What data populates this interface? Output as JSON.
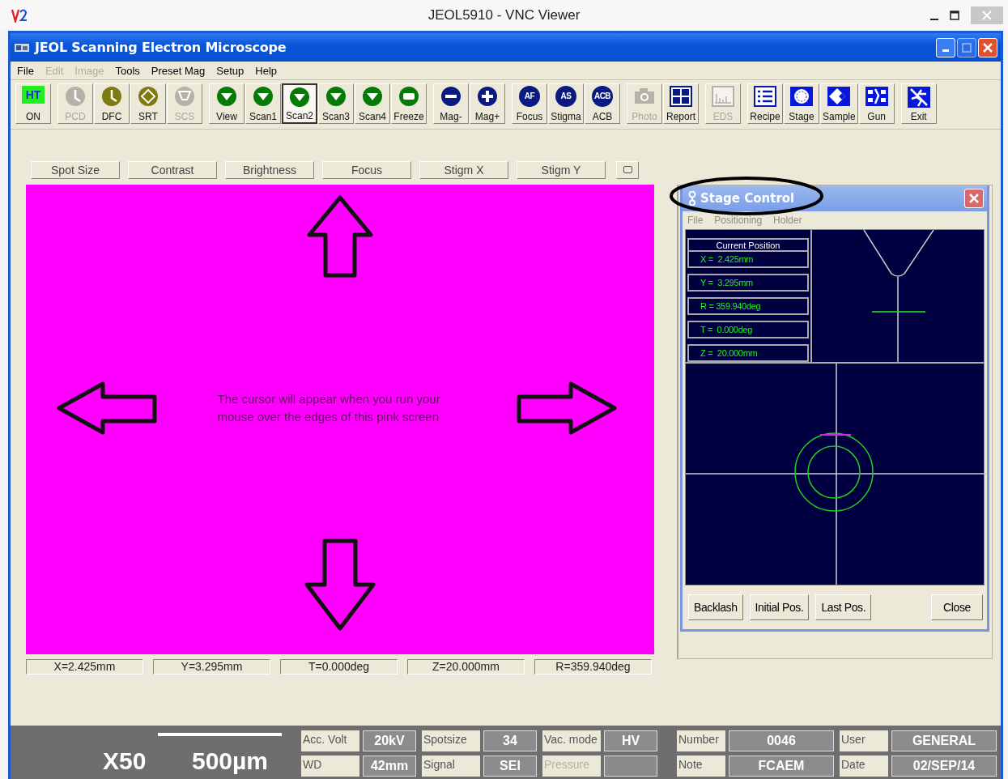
{
  "vnc_window": {
    "title": "JEOL5910 - VNC Viewer"
  },
  "app": {
    "title": "JEOL Scanning Electron Microscope"
  },
  "menu": [
    {
      "label": "File",
      "disabled": false
    },
    {
      "label": "Edit",
      "disabled": true
    },
    {
      "label": "Image",
      "disabled": true
    },
    {
      "label": "Tools",
      "disabled": false
    },
    {
      "label": "Preset Mag",
      "disabled": false
    },
    {
      "label": "Setup",
      "disabled": false
    },
    {
      "label": "Help",
      "disabled": false
    }
  ],
  "toolbar": [
    [
      {
        "label": "ON",
        "kind": "ht",
        "icon_text": "HT",
        "disabled": false,
        "selected": false
      }
    ],
    [
      {
        "label": "PCD",
        "kind": "gauge",
        "disabled": true,
        "selected": false
      },
      {
        "label": "DFC",
        "kind": "gauge",
        "disabled": false,
        "selected": false
      },
      {
        "label": "SRT",
        "kind": "srt",
        "disabled": false,
        "selected": false
      },
      {
        "label": "SCS",
        "kind": "scs",
        "disabled": true,
        "selected": false
      }
    ],
    [
      {
        "label": "View",
        "kind": "down",
        "disabled": false,
        "selected": false
      },
      {
        "label": "Scan1",
        "kind": "down",
        "disabled": false,
        "selected": false
      },
      {
        "label": "Scan2",
        "kind": "down",
        "disabled": false,
        "selected": true
      },
      {
        "label": "Scan3",
        "kind": "down",
        "disabled": false,
        "selected": false
      },
      {
        "label": "Scan4",
        "kind": "down",
        "disabled": false,
        "selected": false
      },
      {
        "label": "Freeze",
        "kind": "freeze",
        "disabled": false,
        "selected": false
      }
    ],
    [
      {
        "label": "Mag-",
        "kind": "minus",
        "disabled": false,
        "selected": false
      },
      {
        "label": "Mag+",
        "kind": "plus",
        "disabled": false,
        "selected": false
      }
    ],
    [
      {
        "label": "Focus",
        "kind": "emblem",
        "icon_text": "AF",
        "disabled": false,
        "selected": false
      },
      {
        "label": "Stigma",
        "kind": "emblem",
        "icon_text": "AS",
        "disabled": false,
        "selected": false
      },
      {
        "label": "ACB",
        "kind": "emblem",
        "icon_text": "ACB",
        "disabled": false,
        "selected": false
      }
    ],
    [
      {
        "label": "Photo",
        "kind": "camera",
        "disabled": true,
        "selected": false
      },
      {
        "label": "Report",
        "kind": "report",
        "disabled": false,
        "selected": false
      }
    ],
    [
      {
        "label": "EDS",
        "kind": "eds",
        "disabled": true,
        "selected": false
      }
    ],
    [
      {
        "label": "Recipe",
        "kind": "recipe",
        "disabled": false,
        "selected": false
      },
      {
        "label": "Stage",
        "kind": "stage",
        "disabled": false,
        "selected": false
      },
      {
        "label": "Sample",
        "kind": "sample",
        "disabled": false,
        "selected": false
      },
      {
        "label": "Gun",
        "kind": "gun",
        "disabled": false,
        "selected": false
      }
    ],
    [
      {
        "label": "Exit",
        "kind": "exit",
        "disabled": false,
        "selected": false
      }
    ]
  ],
  "adjust_buttons": [
    {
      "label": "Spot Size"
    },
    {
      "label": "Contrast"
    },
    {
      "label": "Brightness"
    },
    {
      "label": "Focus"
    },
    {
      "label": "Stigm X"
    },
    {
      "label": "Stigm Y"
    }
  ],
  "viewer": {
    "message": "The cursor will appear when you run your mouse over the edges of this pink screen"
  },
  "position_readouts": [
    "X=2.425mm",
    "Y=3.295mm",
    "T=0.000deg",
    "Z=20.000mm",
    "R=359.940deg"
  ],
  "stage_control": {
    "title": "Stage Control",
    "menu": [
      {
        "label": "File",
        "disabled": true
      },
      {
        "label": "Positioning",
        "disabled": true
      },
      {
        "label": "Holder",
        "disabled": true
      }
    ],
    "heading": "Current Position",
    "readouts": [
      "X =  2.425mm",
      "Y =  3.295mm",
      "R = 359.940deg",
      "T =  0.000deg",
      "Z =  20.000mm"
    ],
    "buttons": [
      {
        "label": "Backlash"
      },
      {
        "label": "Initial Pos."
      },
      {
        "label": "Last Pos."
      },
      {
        "label": "Close"
      }
    ]
  },
  "status": {
    "magnification": "X50",
    "scale": "500µm",
    "groups": [
      [
        {
          "label": "Acc. Volt",
          "value": "20kV",
          "disabled": false
        },
        {
          "label": "WD",
          "value": "42mm",
          "disabled": false
        }
      ],
      [
        {
          "label": "Spotsize",
          "value": "34",
          "disabled": false
        },
        {
          "label": "Signal",
          "value": "SEI",
          "disabled": false
        }
      ],
      [
        {
          "label": "Vac. mode",
          "value": "HV",
          "disabled": false
        },
        {
          "label": "Pressure",
          "disabled": true
        }
      ],
      [
        {
          "label": "Number",
          "value": "0046",
          "disabled": false
        },
        {
          "label": "Note",
          "value": "FCAEM",
          "disabled": false
        }
      ],
      [
        {
          "label": "User",
          "value": "GENERAL",
          "disabled": false
        },
        {
          "label": "Date",
          "value": "02/SEP/14",
          "disabled": false
        }
      ]
    ]
  }
}
